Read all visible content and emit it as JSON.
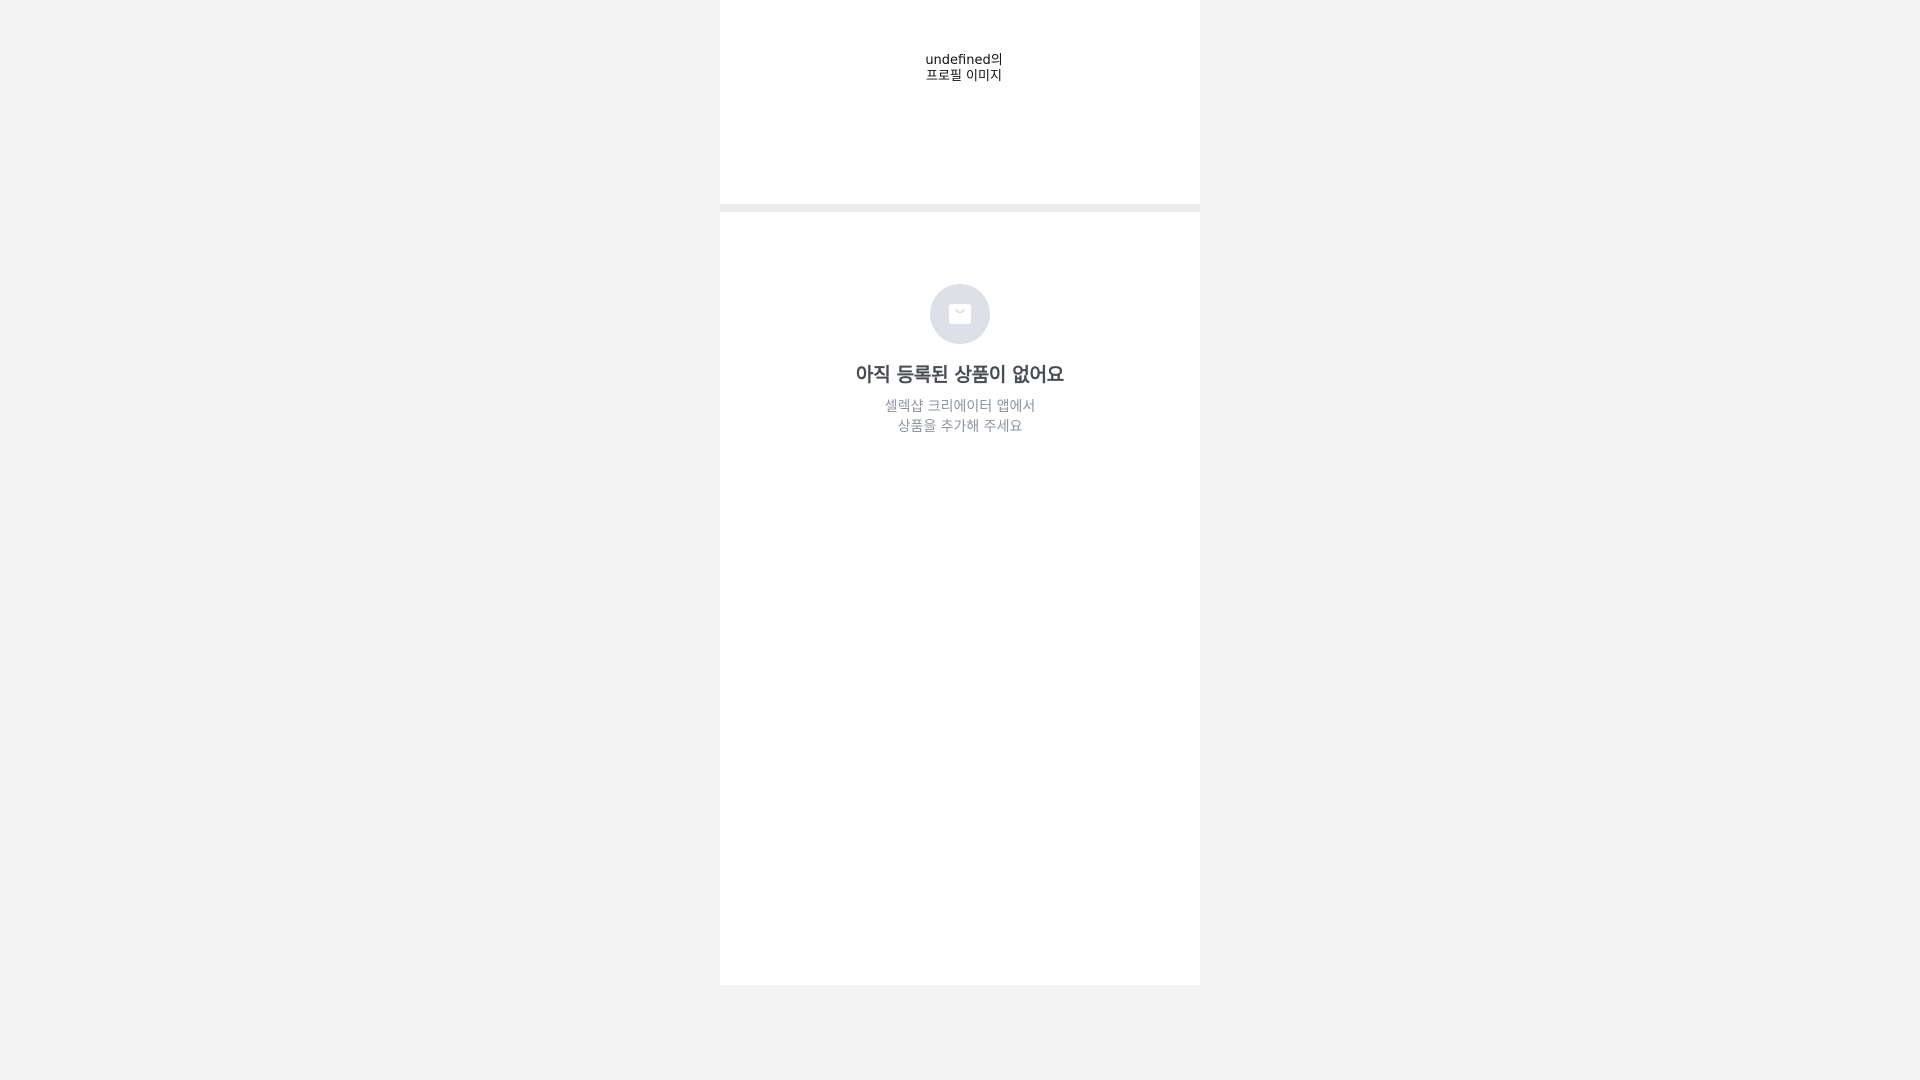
{
  "profile": {
    "image_alt_line1": "undefined의",
    "image_alt_line2": "프로필 이미지"
  },
  "empty_state": {
    "icon": "shopping-bag-icon",
    "title": "아직 등록된 상품이 없어요",
    "description_line1": "셀렉샵 크리에이터 앱에서",
    "description_line2": "상품을 추가해 주세요"
  },
  "colors": {
    "page_background": "#f4f4f4",
    "card_background": "#ffffff",
    "divider": "#ececec",
    "icon_circle": "#dde0e6",
    "title_text": "#484c53",
    "description_text": "#8f959e"
  }
}
